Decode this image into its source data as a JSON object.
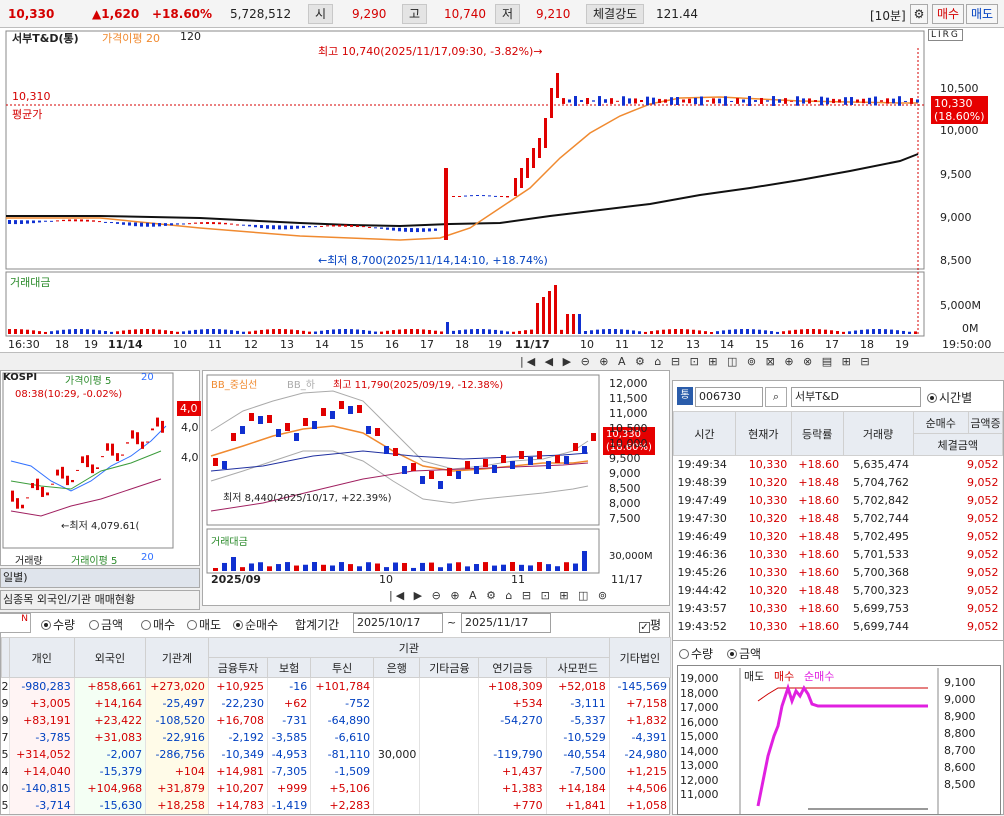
{
  "ticker": {
    "price": "10,330",
    "change": "▲1,620",
    "change_pct": "+18.60%",
    "volume": "5,728,512",
    "open_label": "시",
    "open": "9,290",
    "high_label": "고",
    "high": "10,740",
    "low_label": "저",
    "low": "9,210",
    "strength_label": "체결강도",
    "strength": "121.44",
    "interval": "[10분]",
    "buy_label": "매수",
    "sell_label": "매도"
  },
  "main_chart": {
    "title": "서부T&D(통)",
    "ma_label": "가격이평 20",
    "ma_120": "120",
    "avg_price": "10,310",
    "avg_label": "평균가",
    "high_annot": "최고 10,740(2025/11/17,09:30, -3.82%)→",
    "low_annot": "←최저 8,700(2025/11/14,14:10, +18.74%)",
    "price_tag": "10,330",
    "price_tag_pct": "(18.60%)",
    "y_ticks": [
      "10,500",
      "10,000",
      "9,500",
      "9,000",
      "8,500"
    ],
    "volume_label": "거래대금",
    "vol_ticks": [
      "5,000M",
      "0M"
    ],
    "x_labels": [
      "16:30",
      "18",
      "19",
      "11/14",
      "10",
      "11",
      "12",
      "13",
      "14",
      "15",
      "16",
      "17",
      "18",
      "19",
      "11/17",
      "10",
      "11",
      "12",
      "13",
      "14",
      "15",
      "16",
      "17",
      "18",
      "19",
      "19:50:00"
    ],
    "toolbar_right": "LIRG"
  },
  "left_chart": {
    "title": "KOSPI",
    "ma_label": "가격이평 5",
    "ma2": "20",
    "annot_high": "08:38(10:29, -0.02%)",
    "annot_low": "←최저 4,079.61(",
    "price_tag": "4,0",
    "y1": "4,0",
    "y2": "4,0",
    "vol_label": "거래량",
    "vol_ma": "거래이평 5",
    "vol_ma2": "20"
  },
  "mid_chart": {
    "bb_label": "BB_중심선",
    "bb2": "BB_하",
    "high_annot": "최고 11,790(2025/09/19, -12.38%)",
    "low_annot": "최저 8,440(2025/10/17, +22.39%)",
    "y_ticks": [
      "12,000",
      "11,500",
      "11,000",
      "10,500",
      "10,000",
      "9,500",
      "9,000",
      "8,500",
      "8,000",
      "7,500"
    ],
    "price_tag": "10,330",
    "price_tag_pct": "(18.60%)",
    "vol_label": "거래대금",
    "vol_tick": "30,000M",
    "x_labels": [
      "2025/09",
      "10",
      "11",
      "11/17"
    ]
  },
  "right_panel": {
    "code": "006730",
    "name": "서부T&D",
    "mode": "시간별",
    "headers": [
      "시간",
      "현재가",
      "등락률",
      "거래량",
      "순매수",
      "체결금액"
    ],
    "extra_header": "금액증",
    "rows": [
      [
        "19:49:34",
        "10,330",
        "+18.60",
        "5,635,474",
        "9,052"
      ],
      [
        "19:48:39",
        "10,320",
        "+18.48",
        "5,704,762",
        "9,052"
      ],
      [
        "19:47:49",
        "10,330",
        "+18.60",
        "5,702,842",
        "9,052"
      ],
      [
        "19:47:30",
        "10,320",
        "+18.48",
        "5,702,744",
        "9,052"
      ],
      [
        "19:46:49",
        "10,320",
        "+18.48",
        "5,702,495",
        "9,052"
      ],
      [
        "19:46:36",
        "10,330",
        "+18.60",
        "5,701,533",
        "9,052"
      ],
      [
        "19:45:26",
        "10,330",
        "+18.60",
        "5,700,368",
        "9,052"
      ],
      [
        "19:44:42",
        "10,320",
        "+18.48",
        "5,700,323",
        "9,052"
      ],
      [
        "19:43:57",
        "10,330",
        "+18.60",
        "5,699,753",
        "9,052"
      ],
      [
        "19:43:52",
        "10,330",
        "+18.60",
        "5,699,744",
        "9,052"
      ]
    ]
  },
  "right_chart": {
    "opt_qty": "수량",
    "opt_amt": "금액",
    "legend_sell": "매도",
    "legend_buy": "매수",
    "legend_net": "순매수",
    "left_ticks": [
      "19,000",
      "18,000",
      "17,000",
      "16,000",
      "15,000",
      "14,000",
      "13,000",
      "12,000",
      "11,000"
    ],
    "right_ticks": [
      "9,100",
      "9,000",
      "8,900",
      "8,800",
      "8,700",
      "8,600",
      "8,500"
    ]
  },
  "table_panel": {
    "tab_daily": "일별)",
    "tab_flow": "심종목 외국인/기관 매매현황",
    "opt_qty": "수량",
    "opt_amt": "금액",
    "opt_buy": "매수",
    "opt_sell": "매도",
    "opt_net": "순매수",
    "period_label": "합계기간",
    "date_from": "2025/10/17",
    "date_to": "2025/11/17",
    "tilde": "~",
    "avg_chk": "평",
    "group_header": "기관",
    "headers": [
      "개인",
      "외국인",
      "기관계",
      "금융투자",
      "보험",
      "투신",
      "은행",
      "기타금융",
      "연기금등",
      "사모펀드",
      "기타법인"
    ],
    "row_prefix": [
      "2",
      "9",
      "9",
      "7",
      "5",
      "4",
      "0",
      "5"
    ],
    "rows": [
      [
        "-980,283",
        "+858,661",
        "+273,020",
        "+10,925",
        "-16",
        "+101,784",
        "",
        "",
        "+108,309",
        "+52,018",
        "-145,569"
      ],
      [
        "+3,005",
        "+14,164",
        "-25,497",
        "-22,230",
        "+62",
        "-752",
        "",
        "",
        "+534",
        "-3,111",
        "+7,158"
      ],
      [
        "+83,191",
        "+23,422",
        "-108,520",
        "+16,708",
        "-731",
        "-64,890",
        "",
        "",
        "-54,270",
        "-5,337",
        "+1,832"
      ],
      [
        "-3,785",
        "+31,083",
        "-22,916",
        "-2,192",
        "-3,585",
        "-6,610",
        "",
        "",
        "",
        "-10,529",
        "-4,391"
      ],
      [
        "+314,052",
        "-2,007",
        "-286,756",
        "-10,349",
        "-4,953",
        "-81,110",
        "30,000",
        "",
        "-119,790",
        "-40,554",
        "-24,980"
      ],
      [
        "+14,040",
        "-15,379",
        "+104",
        "+14,981",
        "-7,305",
        "-1,509",
        "",
        "",
        "+1,437",
        "-7,500",
        "+1,215"
      ],
      [
        "-140,815",
        "+104,968",
        "+31,879",
        "+10,207",
        "+999",
        "+5,106",
        "",
        "",
        "+1,383",
        "+14,184",
        "+4,506"
      ],
      [
        "-3,714",
        "-15,630",
        "+18,258",
        "+14,783",
        "-1,419",
        "+2,283",
        "",
        "",
        "+770",
        "+1,841",
        "+1,058"
      ]
    ]
  }
}
